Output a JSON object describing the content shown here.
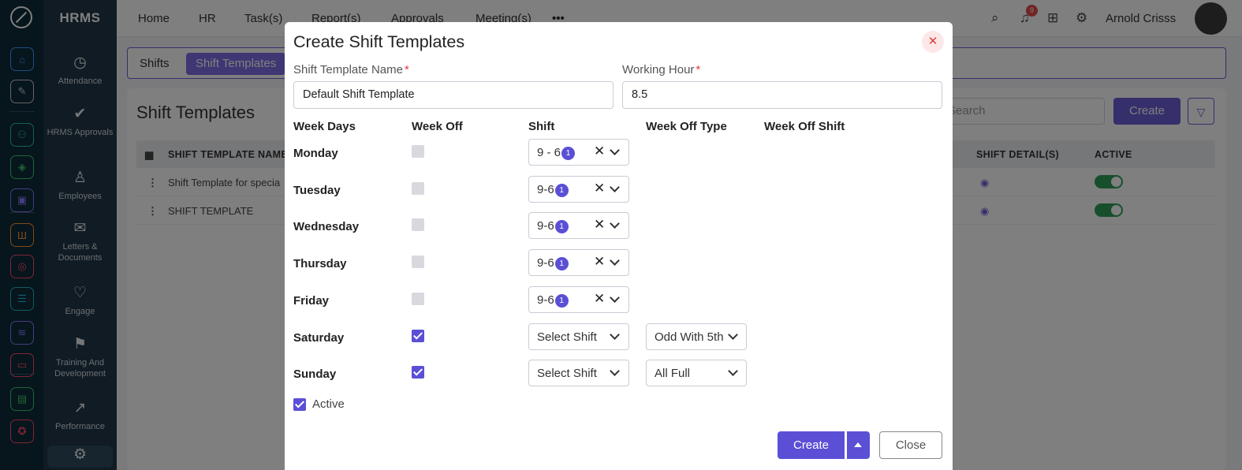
{
  "app": {
    "brand": "HRMS",
    "rail_icons": [
      {
        "name": "home-icon",
        "glyph": "⌂",
        "color": "#3aa0ff"
      },
      {
        "name": "pin-icon",
        "glyph": "✎",
        "color": "#cccccc"
      },
      {
        "name": "people-icon",
        "glyph": "⚇",
        "color": "#2fc29b"
      },
      {
        "name": "layers-icon",
        "glyph": "◈",
        "color": "#3ccf6b"
      },
      {
        "name": "briefcase-icon",
        "glyph": "▣",
        "color": "#8a7cff"
      },
      {
        "name": "chart-icon",
        "glyph": "Ш",
        "color": "#ff9a2e"
      },
      {
        "name": "target-icon",
        "glyph": "◎",
        "color": "#ff4d6b"
      },
      {
        "name": "archive-icon",
        "glyph": "☰",
        "color": "#22b8c9"
      },
      {
        "name": "stack-icon",
        "glyph": "≋",
        "color": "#8a7cff"
      },
      {
        "name": "monitor-icon",
        "glyph": "▭",
        "color": "#ff4d6b"
      },
      {
        "name": "document-icon",
        "glyph": "▤",
        "color": "#3ccf6b"
      },
      {
        "name": "award-icon",
        "glyph": "✪",
        "color": "#ff4d6b"
      }
    ],
    "nav": [
      {
        "label": "Attendance",
        "icon": "calendar-clock-icon",
        "glyph": "◷"
      },
      {
        "label": "HRMS Approvals",
        "icon": "approval-icon",
        "glyph": "✔"
      },
      {
        "label": "Employees",
        "icon": "user-icon",
        "glyph": "♙"
      },
      {
        "label": "Letters & Documents",
        "icon": "letters-icon",
        "glyph": "✉"
      },
      {
        "label": "Engage",
        "icon": "handshake-icon",
        "glyph": "♡"
      },
      {
        "label": "Training And Development",
        "icon": "training-icon",
        "glyph": "⚑"
      },
      {
        "label": "Performance",
        "icon": "performance-icon",
        "glyph": "↗"
      },
      {
        "label": "",
        "icon": "settings-icon",
        "glyph": "⚙"
      }
    ],
    "topnav": [
      "Home",
      "HR",
      "Task(s)",
      "Report(s)",
      "Approvals",
      "Meeting(s)"
    ],
    "notifications_count": "9",
    "user_name": "Arnold Crisss",
    "tabs": [
      "Shifts",
      "Shift Templates"
    ]
  },
  "content": {
    "title": "Shift Templates",
    "search_placeholder": "Search",
    "create_label": "Create",
    "columns": [
      "SHIFT TEMPLATE NAME",
      "SHIFT DETAIL(S)",
      "ACTIVE"
    ],
    "rows": [
      {
        "name": "Shift Template for specia"
      },
      {
        "name": "SHIFT TEMPLATE"
      }
    ]
  },
  "modal": {
    "title": "Create Shift Templates",
    "template_name_label": "Shift Template Name",
    "template_name_value": "Default Shift Template",
    "working_hour_label": "Working Hour",
    "working_hour_value": "8.5",
    "columns": {
      "days": "Week Days",
      "week_off": "Week Off",
      "shift": "Shift",
      "week_off_type": "Week Off Type",
      "week_off_shift": "Week Off Shift"
    },
    "days": [
      {
        "day": "Monday",
        "week_off": false,
        "shift": "9 - 6",
        "count": "1",
        "week_off_type": ""
      },
      {
        "day": "Tuesday",
        "week_off": false,
        "shift": "9-6",
        "count": "1",
        "week_off_type": ""
      },
      {
        "day": "Wednesday",
        "week_off": false,
        "shift": "9-6",
        "count": "1",
        "week_off_type": ""
      },
      {
        "day": "Thursday",
        "week_off": false,
        "shift": "9-6",
        "count": "1",
        "week_off_type": ""
      },
      {
        "day": "Friday",
        "week_off": false,
        "shift": "9-6",
        "count": "1",
        "week_off_type": ""
      },
      {
        "day": "Saturday",
        "week_off": true,
        "shift": "Select Shift",
        "count": "",
        "week_off_type": "Odd With 5th"
      },
      {
        "day": "Sunday",
        "week_off": true,
        "shift": "Select Shift",
        "count": "",
        "week_off_type": "All Full"
      }
    ],
    "active_label": "Active",
    "active_checked": true,
    "create_label": "Create",
    "close_label": "Close"
  },
  "colors": {
    "accent": "#5b4fd6",
    "danger": "#e23b3b",
    "success": "#2e9e5b"
  }
}
